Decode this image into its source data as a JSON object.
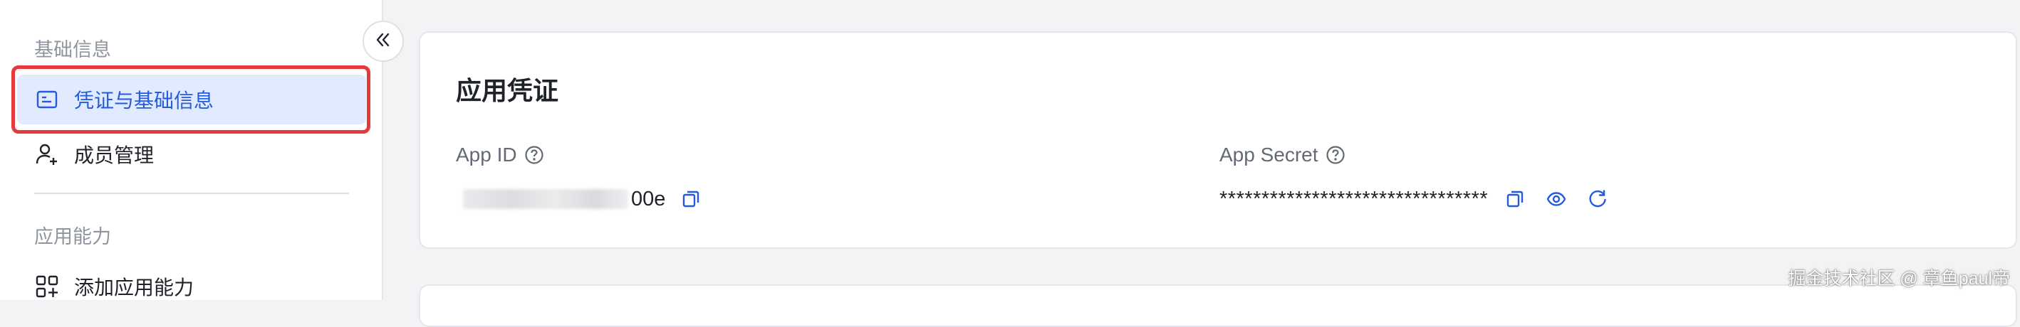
{
  "sidebar": {
    "section_basic": "基础信息",
    "items_basic": [
      {
        "label": "凭证与基础信息",
        "icon": "credential-card-icon",
        "active": true
      },
      {
        "label": "成员管理",
        "icon": "member-add-icon",
        "active": false
      }
    ],
    "section_capability": "应用能力",
    "items_capability": [
      {
        "label": "添加应用能力",
        "icon": "add-capability-icon",
        "active": false
      }
    ],
    "collapse_icon": "double-chevron-left-icon"
  },
  "card": {
    "title": "应用凭证",
    "app_id": {
      "label": "App ID",
      "value_visible_suffix": "00e"
    },
    "app_secret": {
      "label": "App Secret",
      "value": "********************************"
    }
  },
  "watermark": "掘金技术社区 @ 章鱼paul帝",
  "colors": {
    "accent": "#245bdb",
    "active_bg": "#e1eaff",
    "highlight_border": "#e5393b",
    "page_bg": "#f2f3f5"
  }
}
